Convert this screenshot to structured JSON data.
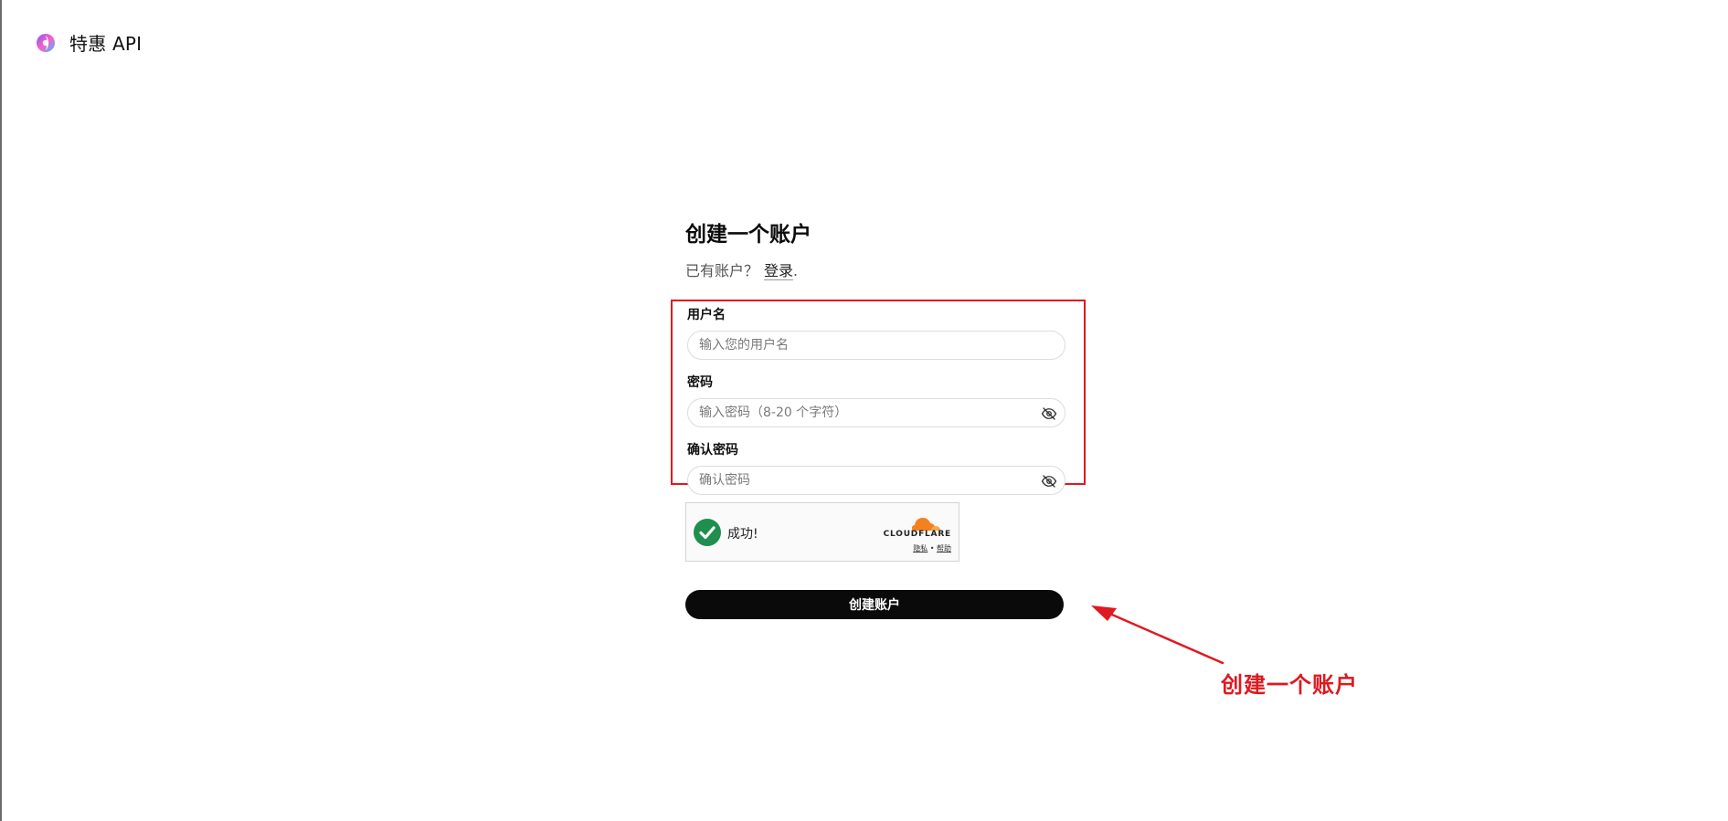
{
  "header": {
    "brand_name": "特惠 API",
    "logo_icon": "brand-logo-icon"
  },
  "form": {
    "title": "创建一个账户",
    "have_account_text": "已有账户？",
    "login_link": "登录",
    "period": ".",
    "fields": [
      {
        "label": "用户名",
        "placeholder": "输入您的用户名",
        "value": ""
      },
      {
        "label": "密码",
        "placeholder": "输入密码（8-20 个字符）",
        "value": "",
        "icon": "eye-off-icon"
      },
      {
        "label": "确认密码",
        "placeholder": "确认密码",
        "value": "",
        "icon": "eye-off-icon"
      }
    ],
    "captcha": {
      "status": "成功!",
      "provider": "CLOUDFLARE",
      "privacy": "隐私",
      "separator": "•",
      "help": "帮助"
    },
    "submit_label": "创建账户"
  },
  "annotation": {
    "text": "创建一个账户",
    "color": "#e0181f"
  },
  "colors": {
    "highlight_border": "#e0181f",
    "button_bg": "#0a0a0a",
    "success_green": "#1f8f4e",
    "cloudflare_orange": "#f48120"
  }
}
